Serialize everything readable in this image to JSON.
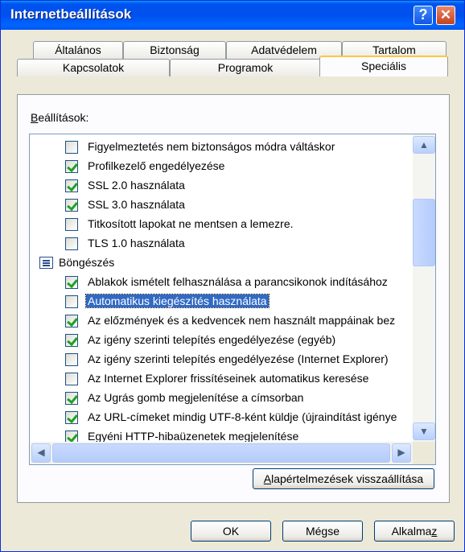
{
  "window": {
    "title": "Internetbeállítások",
    "help_glyph": "?",
    "close_glyph": "✕"
  },
  "tabs": {
    "row_back": [
      "Általános",
      "Biztonság",
      "Adatvédelem",
      "Tartalom"
    ],
    "row_front": [
      "Kapcsolatok",
      "Programok",
      "Speciális"
    ],
    "active": "Speciális"
  },
  "settings": {
    "label_access": "B",
    "label_rest": "eállítások:",
    "items": [
      {
        "type": "checkbox",
        "label": "Figyelmeztetés nem biztonságos módra váltáskor",
        "checked": false
      },
      {
        "type": "checkbox",
        "label": "Profilkezelő engedélyezése",
        "checked": true
      },
      {
        "type": "checkbox",
        "label": "SSL 2.0 használata",
        "checked": true
      },
      {
        "type": "checkbox",
        "label": "SSL 3.0 használata",
        "checked": true
      },
      {
        "type": "checkbox",
        "label": "Titkosított lapokat ne mentsen a lemezre.",
        "checked": false
      },
      {
        "type": "checkbox",
        "label": "TLS 1.0 használata",
        "checked": false
      },
      {
        "type": "category",
        "label": "Böngészés",
        "icon": "list-category-icon"
      },
      {
        "type": "checkbox",
        "label": "Ablakok ismételt felhasználása a parancsikonok indításához",
        "checked": true
      },
      {
        "type": "checkbox",
        "label": "Automatikus kiegészítés használata",
        "checked": false,
        "selected": true
      },
      {
        "type": "checkbox",
        "label": "Az előzmények és a kedvencek nem használt mappáinak bez",
        "checked": true
      },
      {
        "type": "checkbox",
        "label": "Az igény szerinti telepítés engedélyezése (egyéb)",
        "checked": true
      },
      {
        "type": "checkbox",
        "label": "Az igény szerinti telepítés engedélyezése (Internet Explorer)",
        "checked": false
      },
      {
        "type": "checkbox",
        "label": "Az Internet Explorer frissítéseinek automatikus keresése",
        "checked": false
      },
      {
        "type": "checkbox",
        "label": "Az Ugrás gomb megjelenítése a címsorban",
        "checked": true
      },
      {
        "type": "checkbox",
        "label": "Az URL-címeket mindig UTF-8-ként küldje (újraindítást igénye",
        "checked": true
      },
      {
        "type": "checkbox",
        "label": "Egyéni HTTP-hibaüzenetek megjelenítése",
        "checked": true
      }
    ]
  },
  "scroll": {
    "up": "▲",
    "down": "▼",
    "left": "◀",
    "right": "▶"
  },
  "buttons": {
    "restore_access": "A",
    "restore_rest": "lapértelmezések visszaállítása",
    "ok": "OK",
    "cancel": "Mégse",
    "apply_pre": "Alkalma",
    "apply_access": "z"
  },
  "colors": {
    "titlebar": "#0053ee",
    "selection": "#316ac5",
    "check": "#21a121",
    "dialog_bg": "#ece9d8"
  }
}
